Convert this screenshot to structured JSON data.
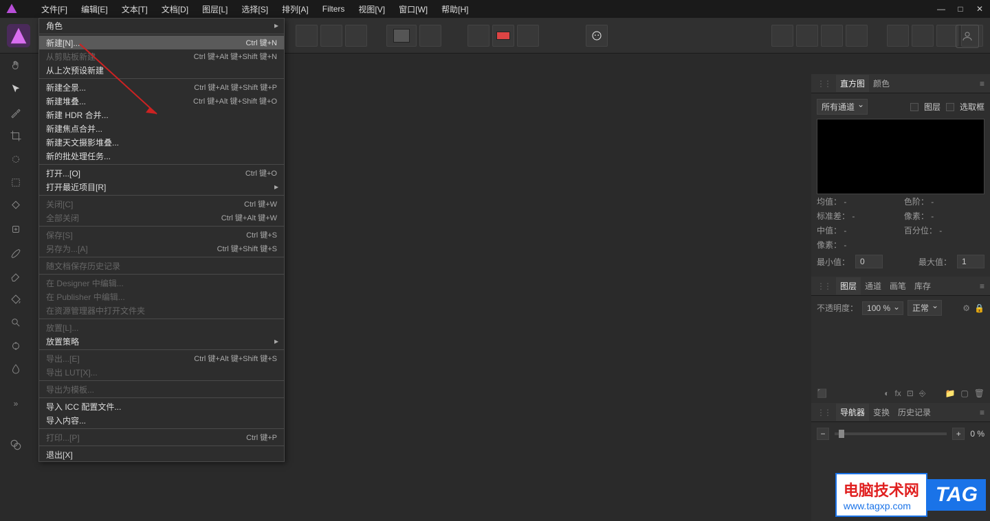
{
  "menubar": {
    "items": [
      "文件[F]",
      "编辑[E]",
      "文本[T]",
      "文档[D]",
      "图层[L]",
      "选择[S]",
      "排列[A]",
      "Filters",
      "视图[V]",
      "窗口[W]",
      "帮助[H]"
    ]
  },
  "dropdown": {
    "groups": [
      [
        {
          "label": "角色",
          "shortcut": "",
          "submenu": true
        }
      ],
      [
        {
          "label": "新建[N]...",
          "shortcut": "Ctrl 键+N",
          "highlighted": true
        },
        {
          "label": "从剪贴板新建",
          "shortcut": "Ctrl 键+Alt 键+Shift 键+N",
          "disabled": true
        },
        {
          "label": "从上次预设新建",
          "shortcut": ""
        }
      ],
      [
        {
          "label": "新建全景...",
          "shortcut": "Ctrl 键+Alt 键+Shift 键+P"
        },
        {
          "label": "新建堆叠...",
          "shortcut": "Ctrl 键+Alt 键+Shift 键+O"
        },
        {
          "label": "新建 HDR 合并...",
          "shortcut": ""
        },
        {
          "label": "新建焦点合并...",
          "shortcut": ""
        },
        {
          "label": "新建天文摄影堆叠...",
          "shortcut": ""
        },
        {
          "label": "新的批处理任务...",
          "shortcut": ""
        }
      ],
      [
        {
          "label": "打开...[O]",
          "shortcut": "Ctrl 键+O"
        },
        {
          "label": "打开最近项目[R]",
          "shortcut": "",
          "submenu": true
        }
      ],
      [
        {
          "label": "关闭[C]",
          "shortcut": "Ctrl 键+W",
          "disabled": true
        },
        {
          "label": "全部关闭",
          "shortcut": "Ctrl 键+Alt 键+W",
          "disabled": true
        }
      ],
      [
        {
          "label": "保存[S]",
          "shortcut": "Ctrl 键+S",
          "disabled": true
        },
        {
          "label": "另存为...[A]",
          "shortcut": "Ctrl 键+Shift 键+S",
          "disabled": true
        }
      ],
      [
        {
          "label": "随文档保存历史记录",
          "shortcut": "",
          "disabled": true
        }
      ],
      [
        {
          "label": "在 Designer 中编辑...",
          "shortcut": "",
          "disabled": true
        },
        {
          "label": "在 Publisher 中编辑...",
          "shortcut": "",
          "disabled": true
        },
        {
          "label": "在资源管理器中打开文件夹",
          "shortcut": "",
          "disabled": true
        }
      ],
      [
        {
          "label": "放置[L]...",
          "shortcut": "",
          "disabled": true
        },
        {
          "label": "放置策略",
          "shortcut": "",
          "submenu": true
        }
      ],
      [
        {
          "label": "导出...[E]",
          "shortcut": "Ctrl 键+Alt 键+Shift 键+S",
          "disabled": true
        },
        {
          "label": "导出 LUT[X]...",
          "shortcut": "",
          "disabled": true
        }
      ],
      [
        {
          "label": "导出为模板...",
          "shortcut": "",
          "disabled": true
        }
      ],
      [
        {
          "label": "导入 ICC 配置文件...",
          "shortcut": ""
        },
        {
          "label": "导入内容...",
          "shortcut": ""
        }
      ],
      [
        {
          "label": "打印...[P]",
          "shortcut": "Ctrl 键+P",
          "disabled": true
        }
      ],
      [
        {
          "label": "退出[X]",
          "shortcut": ""
        }
      ]
    ]
  },
  "panels": {
    "histogram": {
      "tabs": [
        "直方图",
        "颜色"
      ],
      "channel": "所有通道",
      "layer_label": "图层",
      "marquee_label": "选取框",
      "stats": {
        "mean_label": "均值：",
        "mean": "-",
        "stddev_label": "标准差：",
        "stddev": "-",
        "median_label": "中值：",
        "median": "-",
        "pixels_label": "像素：",
        "pixels": "-",
        "levels_label": "色阶：",
        "levels": "-",
        "pixels2_label": "像素：",
        "pixels2": "-",
        "percentile_label": "百分位：",
        "percentile": "-"
      },
      "min_label": "最小值：",
      "min": "0",
      "max_label": "最大值：",
      "max": "1"
    },
    "layers": {
      "tabs": [
        "图层",
        "通道",
        "画笔",
        "库存"
      ],
      "opacity_label": "不透明度：",
      "opacity_value": "100 %",
      "blend_mode": "正常"
    },
    "navigator": {
      "tabs": [
        "导航器",
        "变换",
        "历史记录"
      ],
      "zoom": "0 %"
    }
  },
  "watermark": {
    "line1": "电脑技术网",
    "line2": "www.tagxp.com",
    "tag": "TAG"
  }
}
